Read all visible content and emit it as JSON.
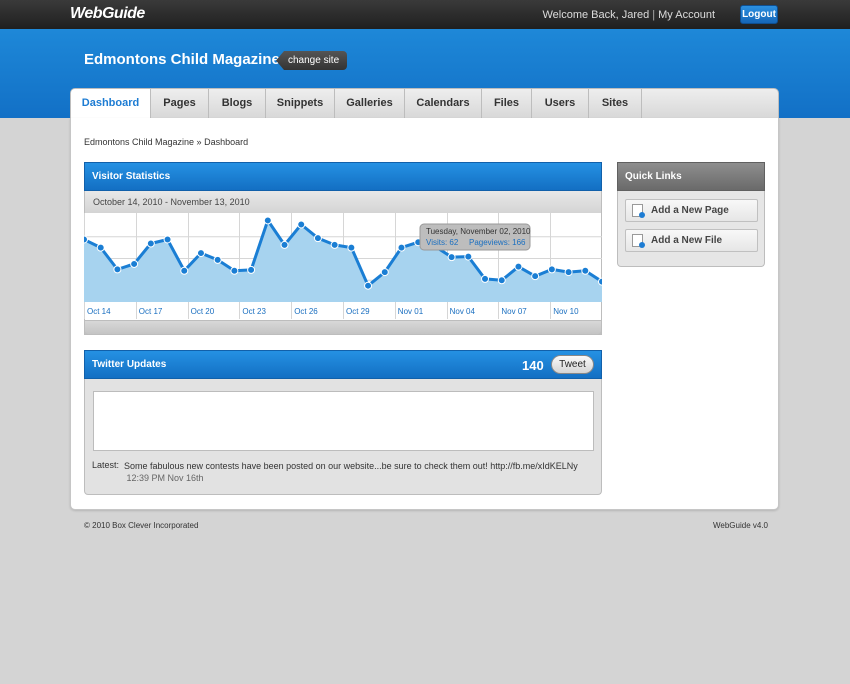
{
  "topbar": {
    "logo": "WebGuide",
    "welcome": "Welcome Back, Jared",
    "separator": "|",
    "my_account": "My Account",
    "logout": "Logout"
  },
  "banner": {
    "site_title": "Edmontons Child Magazine",
    "change_site": "change site"
  },
  "tabs": [
    {
      "label": "Dashboard",
      "active": true
    },
    {
      "label": "Pages"
    },
    {
      "label": "Blogs"
    },
    {
      "label": "Snippets"
    },
    {
      "label": "Galleries"
    },
    {
      "label": "Calendars"
    },
    {
      "label": "Files"
    },
    {
      "label": "Users"
    },
    {
      "label": "Sites"
    }
  ],
  "breadcrumb": "Edmontons Child Magazine » Dashboard",
  "visitor_stats": {
    "title": "Visitor Statistics",
    "range": "October 14, 2010 - November 13, 2010",
    "tooltip": {
      "date": "Tuesday, November 02, 2010",
      "visits": "Visits: 62",
      "pageviews": "Pageviews: 166"
    }
  },
  "chart_data": {
    "type": "area",
    "x_ticks": [
      "Oct 14",
      "Oct 17",
      "Oct 20",
      "Oct 23",
      "Oct 26",
      "Oct 29",
      "Nov 01",
      "Nov 04",
      "Nov 07",
      "Nov 10"
    ],
    "series": [
      {
        "values": [
          230,
          200,
          120,
          140,
          215,
          230,
          115,
          180,
          155,
          115,
          118,
          300,
          210,
          285,
          235,
          210,
          200,
          60,
          110,
          200,
          220,
          205,
          165,
          167,
          85,
          80,
          130,
          95,
          120,
          110,
          115,
          75
        ]
      }
    ],
    "ylim": [
      0,
      320
    ],
    "grid": true,
    "colors": {
      "line": "#1a7ed4",
      "fill": "#a7d3ef",
      "point": "#1a7ed4"
    }
  },
  "twitter": {
    "title": "Twitter Updates",
    "count": "140",
    "tweet_button": "Tweet",
    "latest_label": "Latest:",
    "latest_text": "Some fabulous new contests have been posted on our website...be sure to check them out! http://fb.me/xIdKELNy",
    "latest_time": "12:39 PM Nov 16th"
  },
  "quick_links": {
    "title": "Quick Links",
    "items": [
      {
        "label": "Add a New Page",
        "icon": "page-add-icon"
      },
      {
        "label": "Add a New File",
        "icon": "file-add-icon"
      }
    ]
  },
  "footer": {
    "copyright": "© 2010 Box Clever Incorporated",
    "version": "WebGuide v4.0"
  }
}
